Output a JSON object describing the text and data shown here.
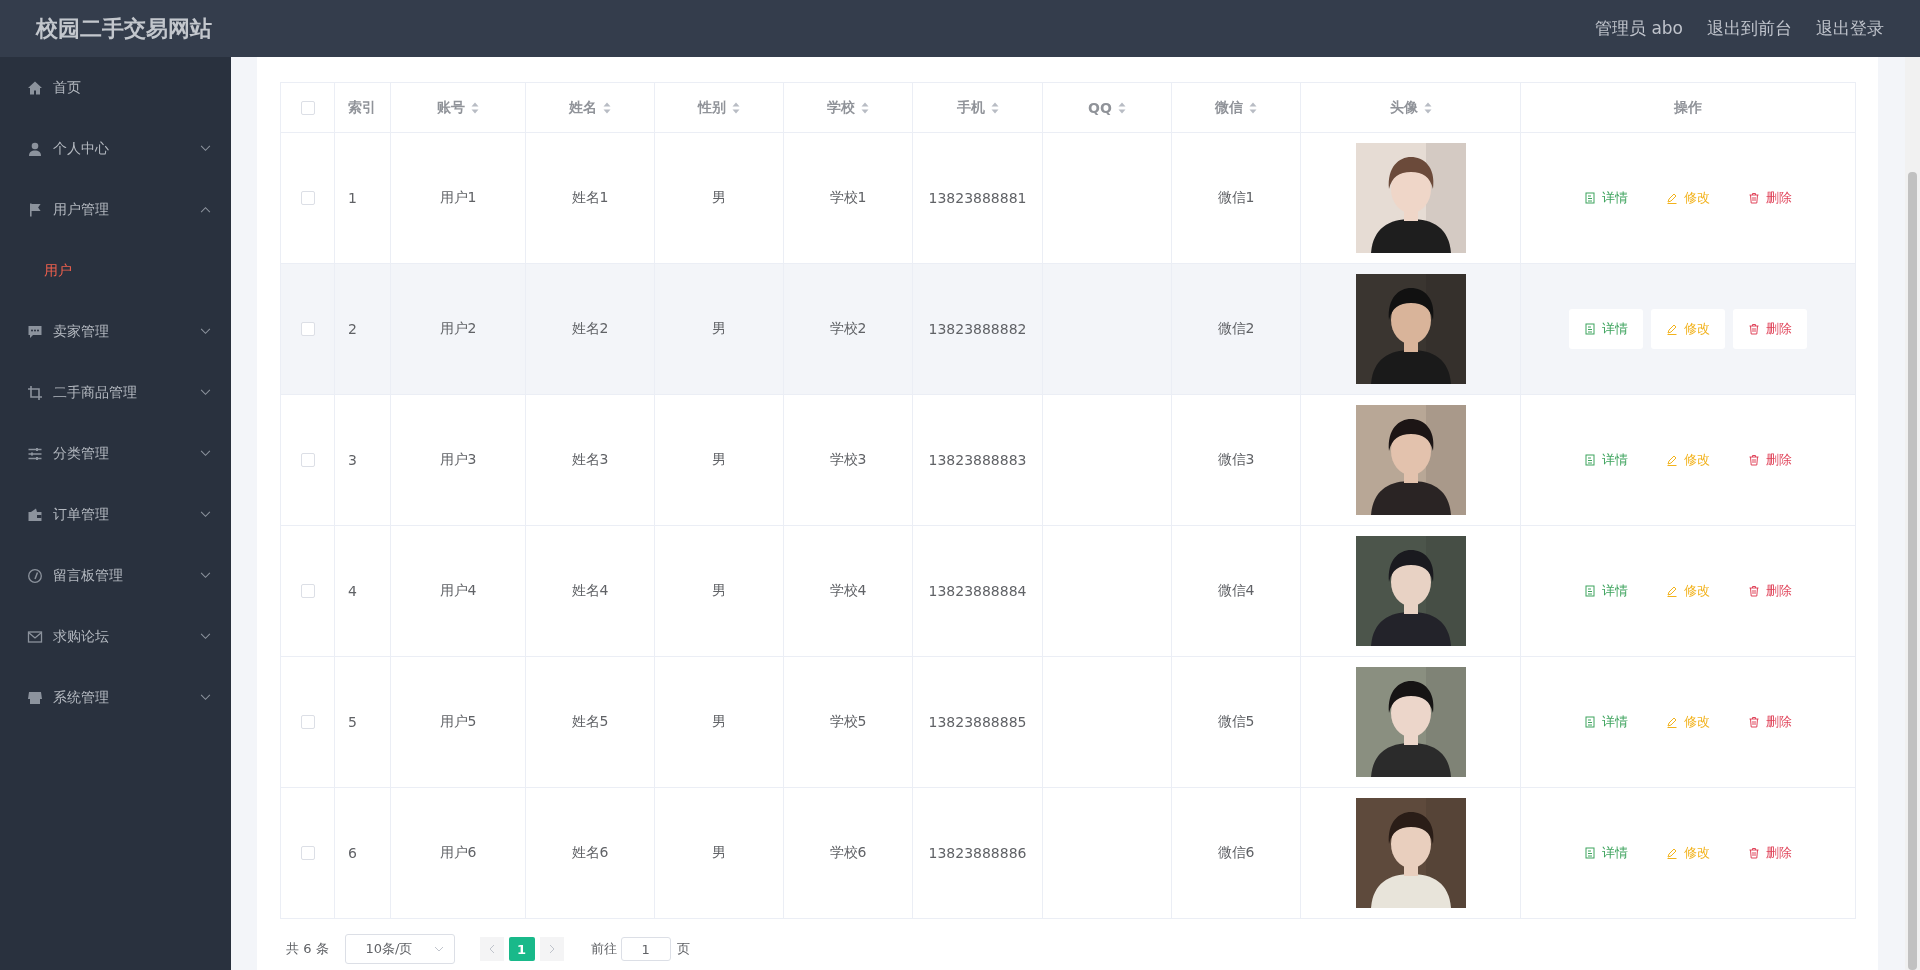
{
  "header": {
    "title": "校园二手交易网站",
    "links": [
      "管理员 abo",
      "退出到前台",
      "退出登录"
    ]
  },
  "sidebar": {
    "items": [
      {
        "label": "首页",
        "expandable": false
      },
      {
        "label": "个人中心",
        "expandable": true,
        "expanded": false
      },
      {
        "label": "用户管理",
        "expandable": true,
        "expanded": true,
        "children": [
          {
            "label": "用户",
            "selected": true
          }
        ]
      },
      {
        "label": "卖家管理",
        "expandable": true,
        "expanded": false
      },
      {
        "label": "二手商品管理",
        "expandable": true,
        "expanded": false
      },
      {
        "label": "分类管理",
        "expandable": true,
        "expanded": false
      },
      {
        "label": "订单管理",
        "expandable": true,
        "expanded": false
      },
      {
        "label": "留言板管理",
        "expandable": true,
        "expanded": false
      },
      {
        "label": "求购论坛",
        "expandable": true,
        "expanded": false
      },
      {
        "label": "系统管理",
        "expandable": true,
        "expanded": false
      }
    ]
  },
  "table": {
    "select_all": {
      "checked": false
    },
    "columns": [
      {
        "label": "索引",
        "sortable": false
      },
      {
        "label": "账号",
        "sortable": true
      },
      {
        "label": "姓名",
        "sortable": true
      },
      {
        "label": "性别",
        "sortable": true
      },
      {
        "label": "学校",
        "sortable": true
      },
      {
        "label": "手机",
        "sortable": true
      },
      {
        "label": "QQ",
        "sortable": true
      },
      {
        "label": "微信",
        "sortable": true
      },
      {
        "label": "头像",
        "sortable": true
      },
      {
        "label": "操作",
        "sortable": false
      }
    ],
    "rows": [
      {
        "checked": false,
        "hovered": false,
        "cells": [
          "1",
          "用户1",
          "姓名1",
          "男",
          "学校1",
          "13823888881",
          "",
          "微信1"
        ],
        "actions": [
          {
            "kind": "detail",
            "label": "详情",
            "color": "#3da35d"
          },
          {
            "kind": "edit",
            "label": "修改",
            "color": "#f2b21c"
          },
          {
            "kind": "delete",
            "label": "删除",
            "color": "#e0445a"
          }
        ]
      },
      {
        "checked": false,
        "hovered": true,
        "cells": [
          "2",
          "用户2",
          "姓名2",
          "男",
          "学校2",
          "13823888882",
          "",
          "微信2"
        ],
        "actions": [
          {
            "kind": "detail",
            "label": "详情",
            "color": "#3da35d"
          },
          {
            "kind": "edit",
            "label": "修改",
            "color": "#f2b21c"
          },
          {
            "kind": "delete",
            "label": "删除",
            "color": "#e0445a"
          }
        ]
      },
      {
        "checked": false,
        "hovered": false,
        "cells": [
          "3",
          "用户3",
          "姓名3",
          "男",
          "学校3",
          "13823888883",
          "",
          "微信3"
        ],
        "actions": [
          {
            "kind": "detail",
            "label": "详情",
            "color": "#3da35d"
          },
          {
            "kind": "edit",
            "label": "修改",
            "color": "#f2b21c"
          },
          {
            "kind": "delete",
            "label": "删除",
            "color": "#e0445a"
          }
        ]
      },
      {
        "checked": false,
        "hovered": false,
        "cells": [
          "4",
          "用户4",
          "姓名4",
          "男",
          "学校4",
          "13823888884",
          "",
          "微信4"
        ],
        "actions": [
          {
            "kind": "detail",
            "label": "详情",
            "color": "#3da35d"
          },
          {
            "kind": "edit",
            "label": "修改",
            "color": "#f2b21c"
          },
          {
            "kind": "delete",
            "label": "删除",
            "color": "#e0445a"
          }
        ]
      },
      {
        "checked": false,
        "hovered": false,
        "cells": [
          "5",
          "用户5",
          "姓名5",
          "男",
          "学校5",
          "13823888885",
          "",
          "微信5"
        ],
        "actions": [
          {
            "kind": "detail",
            "label": "详情",
            "color": "#3da35d"
          },
          {
            "kind": "edit",
            "label": "修改",
            "color": "#f2b21c"
          },
          {
            "kind": "delete",
            "label": "删除",
            "color": "#e0445a"
          }
        ]
      },
      {
        "checked": false,
        "hovered": false,
        "cells": [
          "6",
          "用户6",
          "姓名6",
          "男",
          "学校6",
          "13823888886",
          "",
          "微信6"
        ],
        "actions": [
          {
            "kind": "detail",
            "label": "详情",
            "color": "#3da35d"
          },
          {
            "kind": "edit",
            "label": "修改",
            "color": "#f2b21c"
          },
          {
            "kind": "delete",
            "label": "删除",
            "color": "#e0445a"
          }
        ]
      }
    ]
  },
  "pagination": {
    "total": "共 6 条",
    "page_size": "10条/页",
    "pages": [
      {
        "label": "1",
        "selected": true
      }
    ],
    "prev_disabled": true,
    "next_disabled": true,
    "goto_label": "前往",
    "goto_value": "1",
    "page_suffix": "页"
  }
}
